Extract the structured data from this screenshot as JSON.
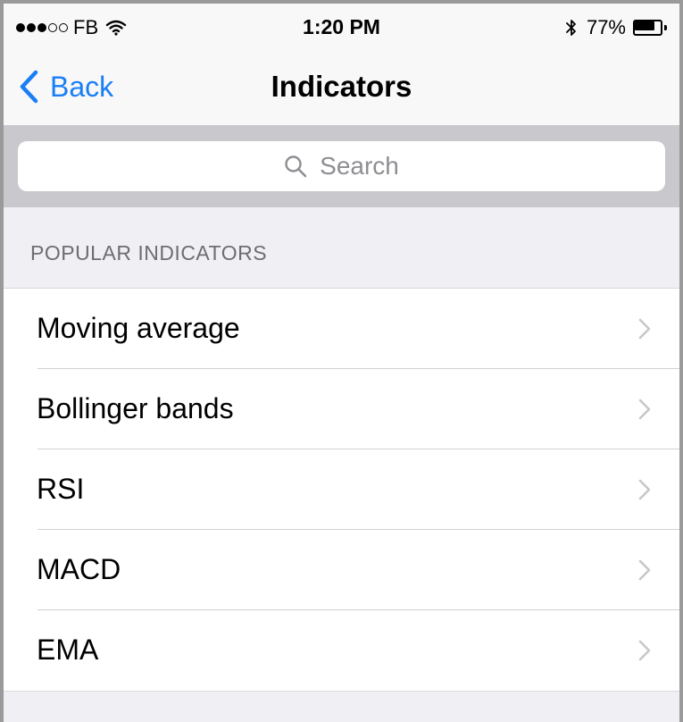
{
  "status_bar": {
    "carrier": "FB",
    "time": "1:20 PM",
    "battery_percent": "77%",
    "battery_level": 0.77,
    "signal_bars_filled": 3,
    "signal_bars_total": 5
  },
  "nav": {
    "back_label": "Back",
    "title": "Indicators",
    "accent_color": "#1a7ef6"
  },
  "search": {
    "placeholder": "Search"
  },
  "section": {
    "header": "POPULAR INDICATORS"
  },
  "list": {
    "items": [
      {
        "label": "Moving average"
      },
      {
        "label": "Bollinger bands"
      },
      {
        "label": "RSI"
      },
      {
        "label": "MACD"
      },
      {
        "label": "EMA"
      }
    ]
  },
  "icons": {
    "back": "chevron-left-icon",
    "search": "search-icon",
    "row": "chevron-right-icon",
    "wifi": "wifi-icon",
    "bluetooth": "bluetooth-icon",
    "battery": "battery-icon"
  }
}
